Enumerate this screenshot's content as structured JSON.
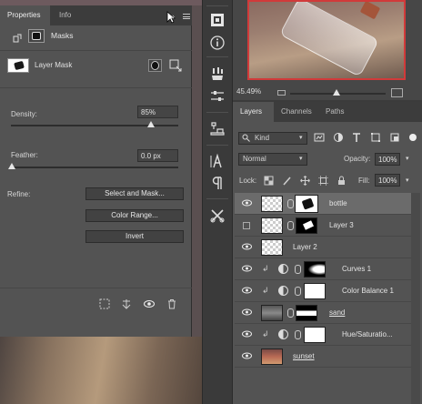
{
  "properties": {
    "tabs": [
      "Properties",
      "Info"
    ],
    "section_title": "Masks",
    "mask_label": "Layer Mask",
    "density_label": "Density:",
    "density_value": "85%",
    "density_level": 0.85,
    "feather_label": "Feather:",
    "feather_value": "0.0 px",
    "refine_label": "Refine:",
    "buttons": {
      "select_and_mask": "Select and Mask...",
      "color_range": "Color Range...",
      "invert": "Invert"
    }
  },
  "navigator": {
    "zoom_value": "45.49%"
  },
  "layers": {
    "tabs": [
      "Layers",
      "Channels",
      "Paths"
    ],
    "filter_kind": "Kind",
    "blend_mode": "Normal",
    "opacity_label": "Opacity:",
    "opacity_value": "100%",
    "lock_label": "Lock:",
    "fill_label": "Fill:",
    "fill_value": "100%",
    "rows": [
      {
        "name": "bottle",
        "selected": true,
        "visible": true
      },
      {
        "name": "Layer 3",
        "selected": false,
        "visible": false
      },
      {
        "name": "Layer 2",
        "selected": false,
        "visible": true
      },
      {
        "name": "Curves 1",
        "selected": false,
        "visible": true
      },
      {
        "name": "Color Balance 1",
        "selected": false,
        "visible": true
      },
      {
        "name": "sand",
        "selected": false,
        "visible": true
      },
      {
        "name": "Hue/Saturatio...",
        "selected": false,
        "visible": true
      },
      {
        "name": "sunset",
        "selected": false,
        "visible": true
      }
    ]
  },
  "icons": {
    "accent_selection": "#d13a3a"
  }
}
